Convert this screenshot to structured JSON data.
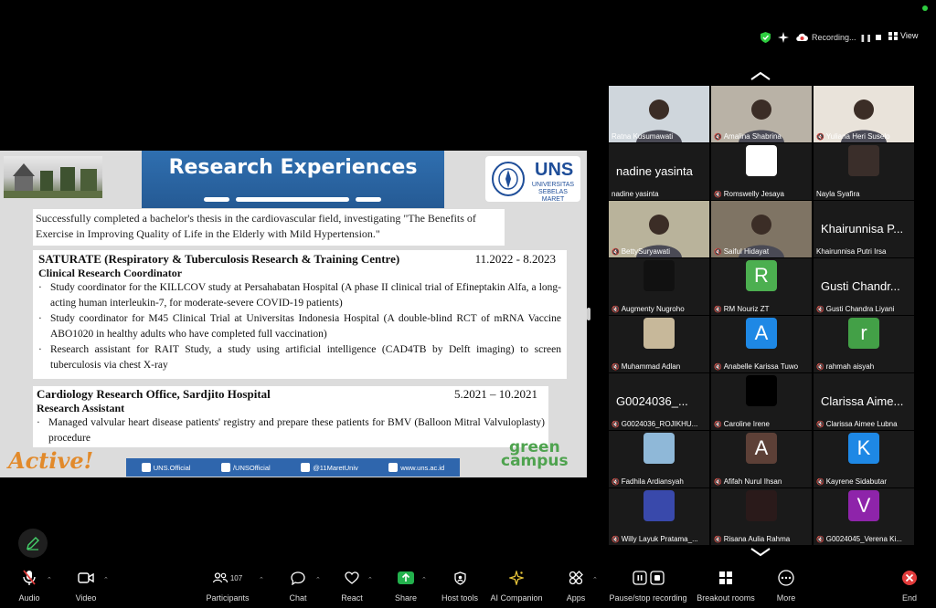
{
  "meeting": {
    "recording_label": "Recording...",
    "view_label": "View"
  },
  "slide": {
    "title": "Research Experiences",
    "uns_logo_text": "UNS",
    "uns_logo_sub": "UNIVERSITAS SEBELAS MARET",
    "intro": "Successfully completed a bachelor's thesis in the cardiovascular field, investigating \"The Benefits of Exercise in Improving Quality of Life in the Elderly with Mild Hypertension.\"",
    "experiences": [
      {
        "org": "SATURATE (Respiratory & Tuberculosis Research & Training Centre)",
        "dates": "11.2022 - 8.2023",
        "role": "Clinical Research Coordinator",
        "bullets": [
          "Study coordinator for the KILLCOV study at Persahabatan Hospital (A phase II clinical trial of Efineptakin Alfa, a long-acting human interleukin-7, for moderate-severe COVID-19 patients)",
          "Study coordinator for M45 Clinical Trial at Universitas Indonesia Hospital (A double-blind RCT of mRNA Vaccine ABO1020 in healthy adults who have completed full vaccination)",
          "Research assistant for RAIT Study, a study using artificial intelligence (CAD4TB by Delft imaging) to screen tuberculosis via chest X-ray"
        ]
      },
      {
        "org": "Cardiology Research Office, Sardjito Hospital",
        "dates": "5.2021 – 10.2021",
        "role": "Research Assistant",
        "bullets": [
          "Managed valvular heart disease patients' registry and prepare these patients for BMV (Balloon Mitral Valvuloplasty) procedure"
        ]
      }
    ],
    "active_logo": "Active!",
    "social": [
      "UNS.Official",
      "/UNSOfficial",
      "@11MaretUniv",
      "www.uns.ac.id"
    ],
    "green_campus": [
      "green",
      "campus"
    ]
  },
  "participants": [
    {
      "name": "Ratna Kusumawati",
      "type": "video",
      "muted": false,
      "active": true,
      "bg": "#cfd6dc"
    },
    {
      "name": "Amalina Shabrina",
      "type": "video",
      "muted": true,
      "bg": "#b9b2a6"
    },
    {
      "name": "Yuliana Heri Suselo",
      "type": "video",
      "muted": true,
      "bg": "#e9e3da"
    },
    {
      "name": "nadine yasinta",
      "type": "name",
      "display": "nadine yasinta",
      "muted": false
    },
    {
      "name": "Romswelly Jesaya",
      "type": "avatar",
      "muted": true,
      "color": "#ffffff",
      "letter": ""
    },
    {
      "name": "Nayla Syafira",
      "type": "avatar",
      "muted": false,
      "color": "#3a2e2a",
      "letter": ""
    },
    {
      "name": "BettySuryawati",
      "type": "video",
      "muted": true,
      "bg": "#b9b39b"
    },
    {
      "name": "Saiful Hidayat",
      "type": "video",
      "muted": true,
      "bg": "#7f7464"
    },
    {
      "name": "Khairunnisa Putri Irsa",
      "type": "name",
      "display": "Khairunnisa P...",
      "muted": false
    },
    {
      "name": "Augmenty Nugroho",
      "type": "avatar",
      "muted": true,
      "color": "#111111",
      "letter": ""
    },
    {
      "name": "RM Nouriz ZT",
      "type": "avatar",
      "muted": true,
      "color": "#4caf50",
      "letter": "R"
    },
    {
      "name": "Gusti Chandra Liyani",
      "type": "name",
      "display": "Gusti Chandr...",
      "muted": true
    },
    {
      "name": "Muhammad Adlan",
      "type": "avatar",
      "muted": true,
      "color": "#c7b89a",
      "letter": ""
    },
    {
      "name": "Anabelle Karissa Tuwo",
      "type": "avatar",
      "muted": true,
      "color": "#1e88e5",
      "letter": "A"
    },
    {
      "name": "rahmah aisyah",
      "type": "avatar",
      "muted": true,
      "color": "#43a047",
      "letter": "r"
    },
    {
      "name": "G0024036_ROJIKHU...",
      "type": "name",
      "display": "G0024036_...",
      "muted": true
    },
    {
      "name": "Caroline Irene",
      "type": "avatar",
      "muted": true,
      "color": "#000000",
      "letter": ""
    },
    {
      "name": "Clarissa Aimee Lubna",
      "type": "name",
      "display": "Clarissa Aime...",
      "muted": true
    },
    {
      "name": "Fadhila Ardiansyah",
      "type": "avatar",
      "muted": true,
      "color": "#8fb8d8",
      "letter": ""
    },
    {
      "name": "Afifah Nurul Ihsan",
      "type": "avatar",
      "muted": true,
      "color": "#5d4037",
      "letter": "A"
    },
    {
      "name": "Kayrene Sidabutar",
      "type": "avatar",
      "muted": true,
      "color": "#1e88e5",
      "letter": "K"
    },
    {
      "name": "Willy Layuk Pratama_...",
      "type": "avatar",
      "muted": true,
      "color": "#3949ab",
      "letter": ""
    },
    {
      "name": "Risana Aulia Rahma",
      "type": "avatar",
      "muted": true,
      "color": "#2a1a1a",
      "letter": ""
    },
    {
      "name": "G0024045_Verena Ki...",
      "type": "avatar",
      "muted": true,
      "color": "#8e24aa",
      "letter": "V"
    }
  ],
  "toolbar": {
    "audio": "Audio",
    "video": "Video",
    "participants": "Participants",
    "participants_count": "107",
    "chat": "Chat",
    "react": "React",
    "share": "Share",
    "host_tools": "Host tools",
    "ai_companion": "AI Companion",
    "apps": "Apps",
    "pause_recording": "Pause/stop recording",
    "breakout": "Breakout rooms",
    "more": "More",
    "end": "End"
  },
  "colors": {
    "active_speaker": "#45d06a",
    "share_green": "#23b14d",
    "end_red": "#e23b3b",
    "banner_blue": "#2f6fb0"
  }
}
